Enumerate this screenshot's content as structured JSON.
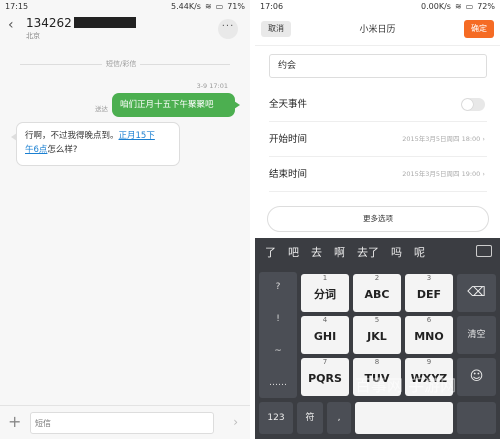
{
  "left": {
    "status": {
      "time": "17:15",
      "speed": "5.44K/s",
      "battery": "71%"
    },
    "contact": "134262",
    "location": "北京",
    "divider": "短信/彩信",
    "messages": {
      "time": "3-9 17:01",
      "sent_status": "送达",
      "outgoing": "咱们正月十五下午聚聚吧",
      "incoming_a": "行啊，不过我得晚点到。",
      "incoming_link1": "正月15下",
      "incoming_link2": "午6点",
      "incoming_b": "怎么样?"
    },
    "compose": {
      "placeholder": "短信"
    }
  },
  "right": {
    "status": {
      "time": "17:06",
      "speed": "0.00K/s",
      "battery": "72%"
    },
    "cancel": "取消",
    "title": "小米日历",
    "confirm": "确定",
    "event_name": "约会",
    "rows": {
      "allday": "全天事件",
      "start_label": "开始时间",
      "start_value": "2015年3月5日周四 18:00",
      "end_label": "结束时间",
      "end_value": "2015年3月5日周四 19:00"
    },
    "more_options": "更多选项",
    "keyboard": {
      "candidates": [
        "了",
        "吧",
        "去",
        "啊",
        "去了",
        "吗",
        "呢"
      ],
      "symbols": [
        "?",
        "!",
        "~",
        "……"
      ],
      "keys": {
        "k1": "分词",
        "k2": "ABC",
        "k3": "DEF",
        "k4": "GHI",
        "k5": "JKL",
        "k6": "MNO",
        "k7": "PQRS",
        "k8": "TUV",
        "k9": "WXYZ",
        "k2n": "2",
        "k3n": "3",
        "k4n": "4",
        "k5n": "5",
        "k6n": "6",
        "k7n": "7",
        "k8n": "8",
        "clear": "清空",
        "num": "123",
        "fu": "符"
      },
      "watermark": "百事网  手游网"
    }
  }
}
